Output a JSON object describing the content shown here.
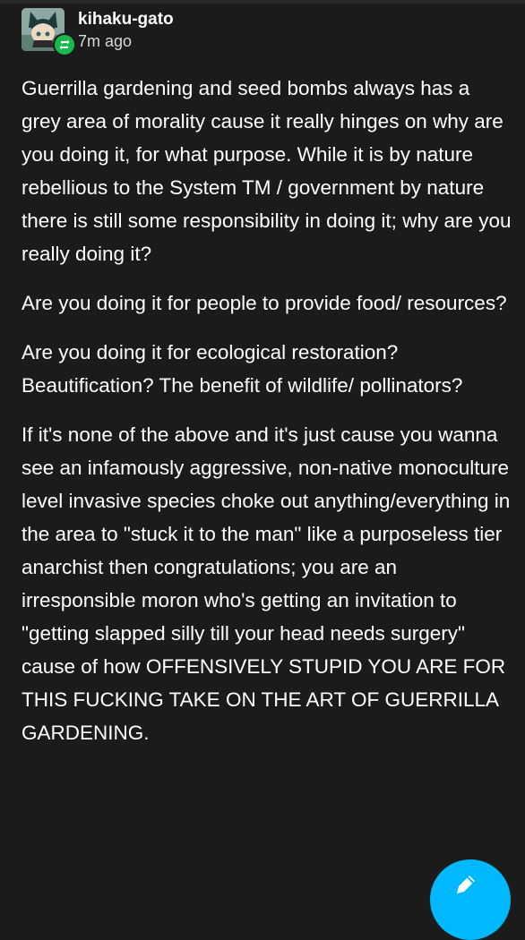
{
  "post": {
    "username": "kihaku-gato",
    "timestamp": "7m ago",
    "paragraphs": [
      "Guerrilla gardening and seed bombs always has a grey area of morality cause it really hinges on why are you doing it, for what purpose. While it is by nature rebellious to the System TM / government by nature there is still some responsibility in doing it; why are you really doing it?",
      "Are you doing it for people to provide food/ resources?",
      "Are you doing it for ecological restoration? Beautification? The benefit of wildlife/ pollinators?",
      "If it's none of the above and it's just cause you wanna see an infamously aggressive, non-native monoculture level invasive species choke out anything/everything in the area to \"stuck it to the man\" like a purposeless tier anarchist then congratulations; you are an irresponsible moron who's getting an invitation to \"getting slapped silly till your head needs surgery\" cause of how OFFENSIVELY STUPID YOU ARE FOR THIS FUCKING TAKE ON THE ART OF GUERRILLA GARDENING."
    ]
  },
  "icons": {
    "avatar": "avatar-image",
    "reblog_badge": "reblog-icon",
    "compose": "pencil-icon"
  },
  "colors": {
    "background": "#1b1b1b",
    "text": "#ffffff",
    "reblog_badge": "#17b94a",
    "compose_button": "#00b8ff"
  }
}
